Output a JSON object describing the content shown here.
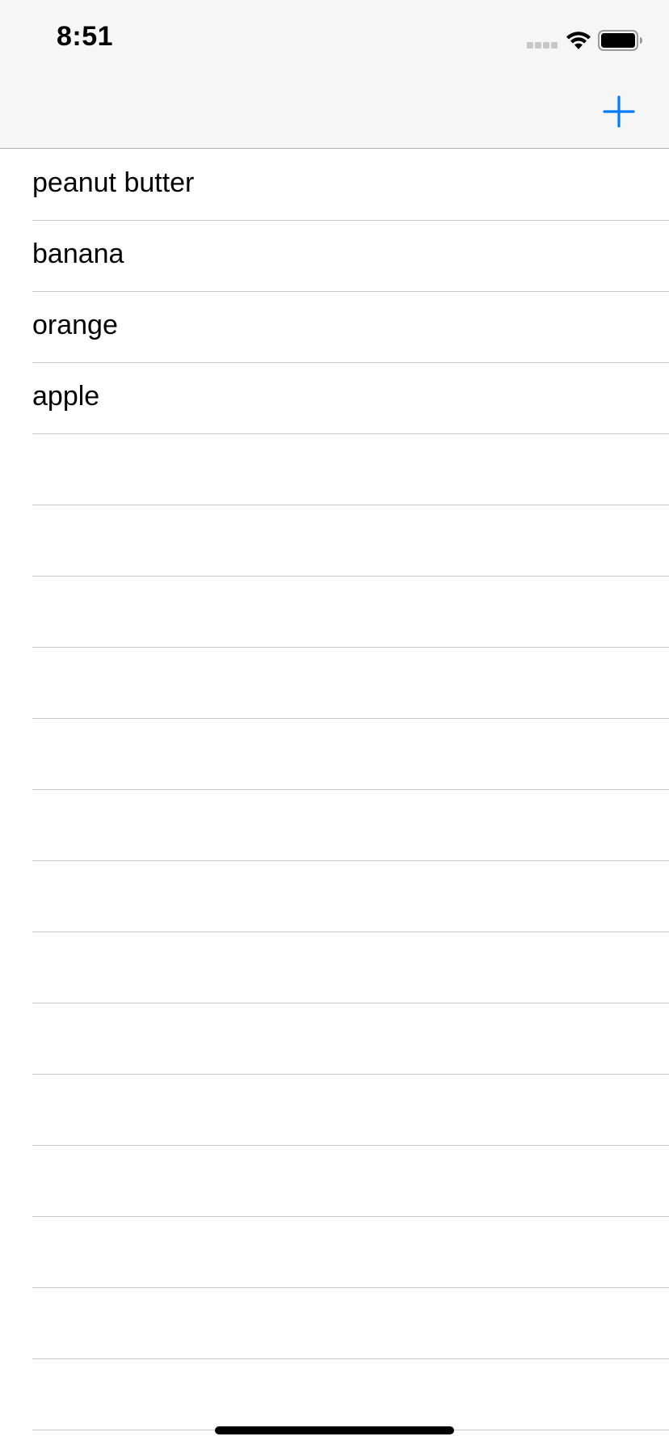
{
  "status_bar": {
    "time": "8:51",
    "icons": [
      "signal-dots-icon",
      "wifi-icon",
      "battery-icon"
    ]
  },
  "nav_bar": {
    "add_button": {
      "icon": "plus-icon",
      "color": "#007aff"
    }
  },
  "list": {
    "items": [
      {
        "label": "peanut butter"
      },
      {
        "label": "banana"
      },
      {
        "label": "orange"
      },
      {
        "label": "apple"
      },
      {
        "label": ""
      },
      {
        "label": ""
      },
      {
        "label": ""
      },
      {
        "label": ""
      },
      {
        "label": ""
      },
      {
        "label": ""
      },
      {
        "label": ""
      },
      {
        "label": ""
      },
      {
        "label": ""
      },
      {
        "label": ""
      },
      {
        "label": ""
      },
      {
        "label": ""
      },
      {
        "label": ""
      },
      {
        "label": ""
      }
    ]
  },
  "colors": {
    "nav_background": "#f6f6f6",
    "separator": "#c8c7cc",
    "accent": "#007aff",
    "text": "#000000"
  }
}
